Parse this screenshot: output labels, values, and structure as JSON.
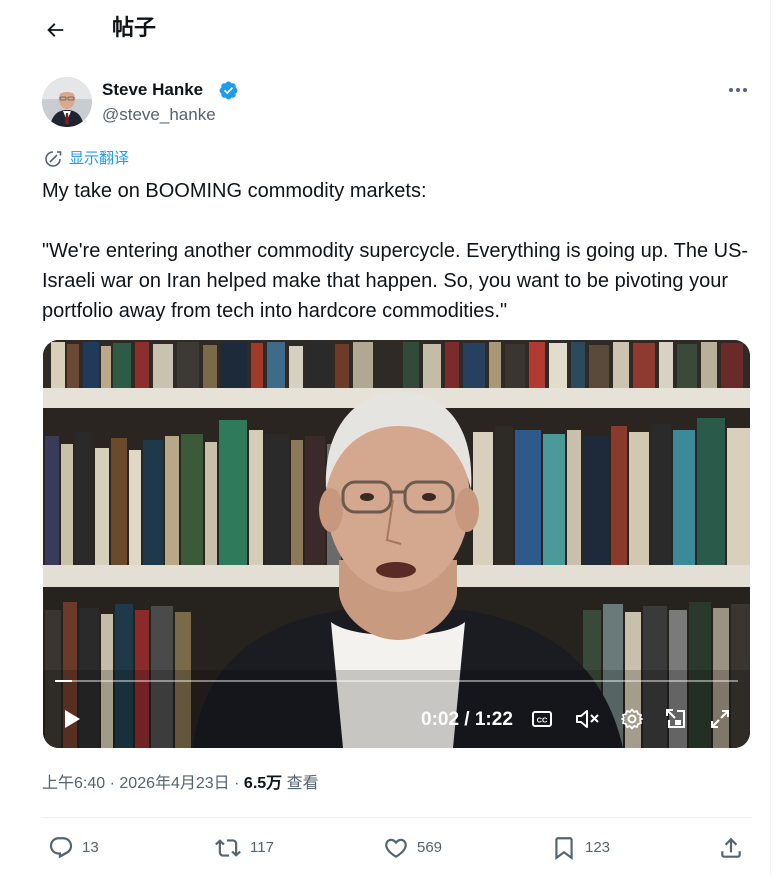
{
  "header": {
    "title": "帖子"
  },
  "author": {
    "name": "Steve Hanke",
    "handle": "@steve_hanke",
    "verified": true
  },
  "translate": {
    "label": "显示翻译"
  },
  "tweet": {
    "line1": "My take on BOOMING commodity markets:",
    "quote": "\"We're entering another commodity supercycle. Everything is going up. The US-Israeli war on Iran helped make that happen. So, you want to be pivoting your portfolio away from tech into hardcore commodities.\""
  },
  "video": {
    "current_time": "0:02",
    "duration": "1:22",
    "time_display": "0:02 / 1:22",
    "progress_fraction": 0.025
  },
  "meta": {
    "time": "上午6:40",
    "date": "2026年4月23日",
    "separator": "·",
    "views_count": "6.5万",
    "views_label": "查看"
  },
  "actions": {
    "replies": "13",
    "reposts": "117",
    "likes": "569",
    "bookmarks": "123"
  },
  "colors": {
    "accent": "#1d9bf0",
    "text": "#0f1419",
    "secondary": "#536471"
  },
  "icons": [
    "back-arrow-icon",
    "verified-badge-icon",
    "more-icon",
    "translate-icon",
    "play-icon",
    "captions-icon",
    "mute-icon",
    "settings-icon",
    "pip-icon",
    "fullscreen-icon",
    "reply-icon",
    "repost-icon",
    "like-icon",
    "bookmark-icon",
    "share-icon"
  ]
}
